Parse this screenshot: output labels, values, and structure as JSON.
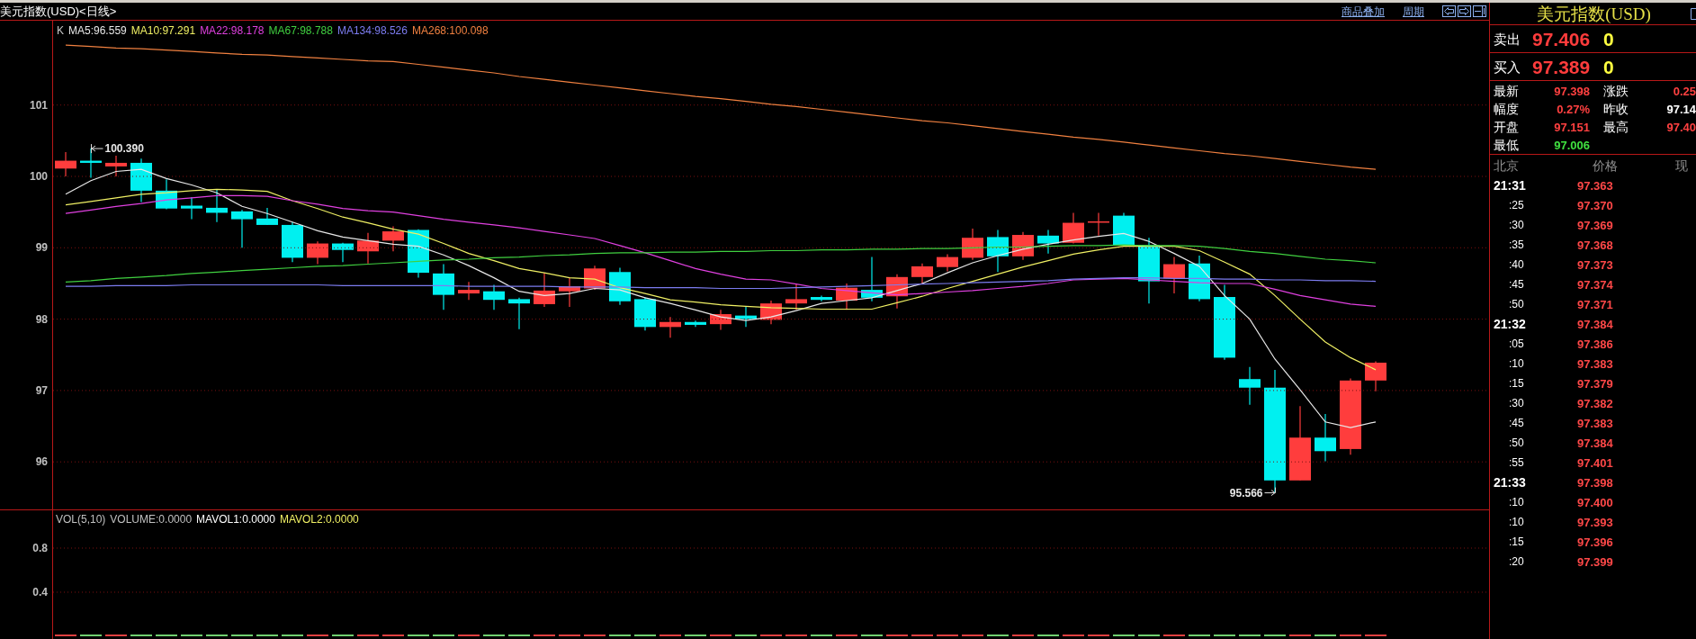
{
  "window": {
    "title": "美元指数(USD)<日线>"
  },
  "toolbar": {
    "links": [
      "商品叠加",
      "周期"
    ]
  },
  "price_chart": {
    "legend": [
      {
        "label": "K",
        "color": "#c8c8c8"
      }
    ],
    "chart_data": {
      "type": "line",
      "ylim": [
        95.334,
        101.917
      ],
      "yticks": [
        101,
        100,
        99,
        98,
        97,
        96
      ],
      "grid": true,
      "series": [
        {
          "name": "MA5:96.559",
          "color": "#e8e8e8",
          "values": [
            99.75,
            99.94,
            100.07,
            100.1,
            99.97,
            99.88,
            99.77,
            99.58,
            99.48,
            99.36,
            99.24,
            99.15,
            99.1,
            99.05,
            99.02,
            98.9,
            98.75,
            98.58,
            98.39,
            98.33,
            98.36,
            98.43,
            98.41,
            98.3,
            98.22,
            98.13,
            98.03,
            97.98,
            98.03,
            98.12,
            98.22,
            98.26,
            98.3,
            98.4,
            98.5,
            98.65,
            98.79,
            98.89,
            98.98,
            99.05,
            99.11,
            99.16,
            99.2,
            99.09,
            98.92,
            98.74,
            98.33,
            98.0,
            97.44,
            97.01,
            96.56,
            96.48,
            96.56
          ]
        },
        {
          "name": "MA10:97.291",
          "color": "#f0f064",
          "values": [
            99.6,
            99.65,
            99.7,
            99.75,
            99.77,
            99.8,
            99.82,
            99.81,
            99.79,
            99.66,
            99.55,
            99.43,
            99.35,
            99.26,
            99.19,
            99.06,
            98.92,
            98.82,
            98.71,
            98.65,
            98.58,
            98.56,
            98.44,
            98.36,
            98.27,
            98.24,
            98.2,
            98.18,
            98.16,
            98.15,
            98.14,
            98.14,
            98.14,
            98.23,
            98.32,
            98.43,
            98.53,
            98.63,
            98.73,
            98.82,
            98.91,
            98.97,
            99.02,
            99.02,
            99.02,
            98.96,
            98.8,
            98.63,
            98.33,
            98.0,
            97.68,
            97.46,
            97.29
          ]
        },
        {
          "name": "MA22:98.178",
          "color": "#e040e0",
          "values": [
            99.48,
            99.53,
            99.58,
            99.62,
            99.67,
            99.7,
            99.73,
            99.73,
            99.72,
            99.66,
            99.61,
            99.55,
            99.52,
            99.5,
            99.45,
            99.4,
            99.36,
            99.32,
            99.28,
            99.23,
            99.18,
            99.13,
            99.03,
            98.93,
            98.82,
            98.71,
            98.63,
            98.56,
            98.55,
            98.49,
            98.43,
            98.4,
            98.37,
            98.34,
            98.36,
            98.38,
            98.4,
            98.43,
            98.46,
            98.5,
            98.55,
            98.56,
            98.57,
            98.55,
            98.53,
            98.51,
            98.5,
            98.5,
            98.42,
            98.33,
            98.27,
            98.21,
            98.18
          ]
        },
        {
          "name": "MA67:98.788",
          "color": "#40d040",
          "values": [
            98.52,
            98.54,
            98.57,
            98.59,
            98.61,
            98.64,
            98.66,
            98.68,
            98.7,
            98.72,
            98.74,
            98.75,
            98.77,
            98.79,
            98.81,
            98.83,
            98.84,
            98.86,
            98.87,
            98.89,
            98.9,
            98.92,
            98.93,
            98.93,
            98.94,
            98.94,
            98.95,
            98.95,
            98.96,
            98.96,
            98.97,
            98.97,
            98.98,
            98.98,
            98.99,
            98.99,
            99.0,
            99.01,
            99.01,
            99.02,
            99.03,
            99.03,
            99.04,
            99.03,
            99.03,
            99.02,
            98.99,
            98.95,
            98.92,
            98.88,
            98.84,
            98.82,
            98.79
          ]
        },
        {
          "name": "MA134:98.526",
          "color": "#7c7cf0",
          "values": [
            98.46,
            98.46,
            98.47,
            98.47,
            98.47,
            98.48,
            98.48,
            98.48,
            98.48,
            98.48,
            98.48,
            98.47,
            98.47,
            98.47,
            98.47,
            98.47,
            98.46,
            98.46,
            98.46,
            98.46,
            98.45,
            98.45,
            98.45,
            98.44,
            98.44,
            98.44,
            98.43,
            98.43,
            98.43,
            98.44,
            98.45,
            98.46,
            98.47,
            98.48,
            98.49,
            98.5,
            98.51,
            98.52,
            98.53,
            98.54,
            98.56,
            98.57,
            98.58,
            98.58,
            98.57,
            98.57,
            98.56,
            98.56,
            98.55,
            98.55,
            98.54,
            98.54,
            98.53
          ]
        },
        {
          "name": "MA268:100.098",
          "color": "#f08040",
          "values": [
            101.84,
            101.82,
            101.8,
            101.79,
            101.77,
            101.75,
            101.73,
            101.71,
            101.7,
            101.68,
            101.66,
            101.64,
            101.62,
            101.61,
            101.57,
            101.53,
            101.49,
            101.45,
            101.4,
            101.36,
            101.32,
            101.28,
            101.24,
            101.2,
            101.16,
            101.12,
            101.09,
            101.05,
            101.01,
            100.98,
            100.94,
            100.9,
            100.86,
            100.82,
            100.78,
            100.75,
            100.71,
            100.67,
            100.63,
            100.59,
            100.55,
            100.52,
            100.48,
            100.44,
            100.4,
            100.36,
            100.32,
            100.29,
            100.25,
            100.21,
            100.17,
            100.13,
            100.1
          ]
        }
      ],
      "annotations": [
        "100.390",
        "95.566"
      ]
    }
  },
  "volume_chart": {
    "legend": [
      {
        "label": "VOL(5,10)",
        "color": "#c0c0c0"
      },
      {
        "label": "VOLUME:0.0000",
        "color": "#c0c0c0"
      },
      {
        "label": "MAVOL1:0.0000",
        "color": "#ffffff"
      },
      {
        "label": "MAVOL2:0.0000",
        "color": "#f0f064"
      }
    ],
    "axis_labels": [
      "0.8",
      "0.4"
    ]
  },
  "quote_panel": {
    "title": "美元指数(USD)",
    "orders": [
      {
        "label": "卖出",
        "price": "97.406",
        "volume": "0"
      },
      {
        "label": "买入",
        "price": "97.389",
        "volume": "0"
      }
    ],
    "stats": [
      {
        "label": "最新",
        "value": "97.398",
        "color": "#ff4040"
      },
      {
        "label": "涨跌",
        "value": "0.25",
        "color": "#ff4040"
      },
      {
        "label": "幅度",
        "value": "0.27%",
        "color": "#ff4040"
      },
      {
        "label": "昨收",
        "value": "97.14",
        "color": "#ffffff"
      },
      {
        "label": "开盘",
        "value": "97.151",
        "color": "#ff4040"
      },
      {
        "label": "最高",
        "value": "97.40",
        "color": "#ff4040"
      },
      {
        "label": "最低",
        "value": "97.006",
        "color": "#40e040"
      }
    ],
    "trades": {
      "columns": [
        "北京",
        "价格",
        "现"
      ],
      "rows": [
        {
          "time": "21:31",
          "kind": "minute",
          "price": "97.363"
        },
        {
          "time": ":25",
          "kind": "second",
          "price": "97.370"
        },
        {
          "time": ":30",
          "kind": "second",
          "price": "97.369"
        },
        {
          "time": ":35",
          "kind": "second",
          "price": "97.368"
        },
        {
          "time": ":40",
          "kind": "second",
          "price": "97.373"
        },
        {
          "time": ":45",
          "kind": "second",
          "price": "97.374"
        },
        {
          "time": ":50",
          "kind": "second",
          "price": "97.371"
        },
        {
          "time": "21:32",
          "kind": "minute",
          "price": "97.384"
        },
        {
          "time": ":05",
          "kind": "second",
          "price": "97.386"
        },
        {
          "time": ":10",
          "kind": "second",
          "price": "97.383"
        },
        {
          "time": ":15",
          "kind": "second",
          "price": "97.379"
        },
        {
          "time": ":30",
          "kind": "second",
          "price": "97.382"
        },
        {
          "time": ":45",
          "kind": "second",
          "price": "97.383"
        },
        {
          "time": ":50",
          "kind": "second",
          "price": "97.384"
        },
        {
          "time": ":55",
          "kind": "second",
          "price": "97.401"
        },
        {
          "time": "21:33",
          "kind": "minute",
          "price": "97.398"
        },
        {
          "time": ":10",
          "kind": "second",
          "price": "97.400"
        },
        {
          "time": ":10",
          "kind": "second",
          "price": "97.393"
        },
        {
          "time": ":15",
          "kind": "second",
          "price": "97.396"
        },
        {
          "time": ":20",
          "kind": "second",
          "price": "97.399"
        }
      ]
    }
  }
}
